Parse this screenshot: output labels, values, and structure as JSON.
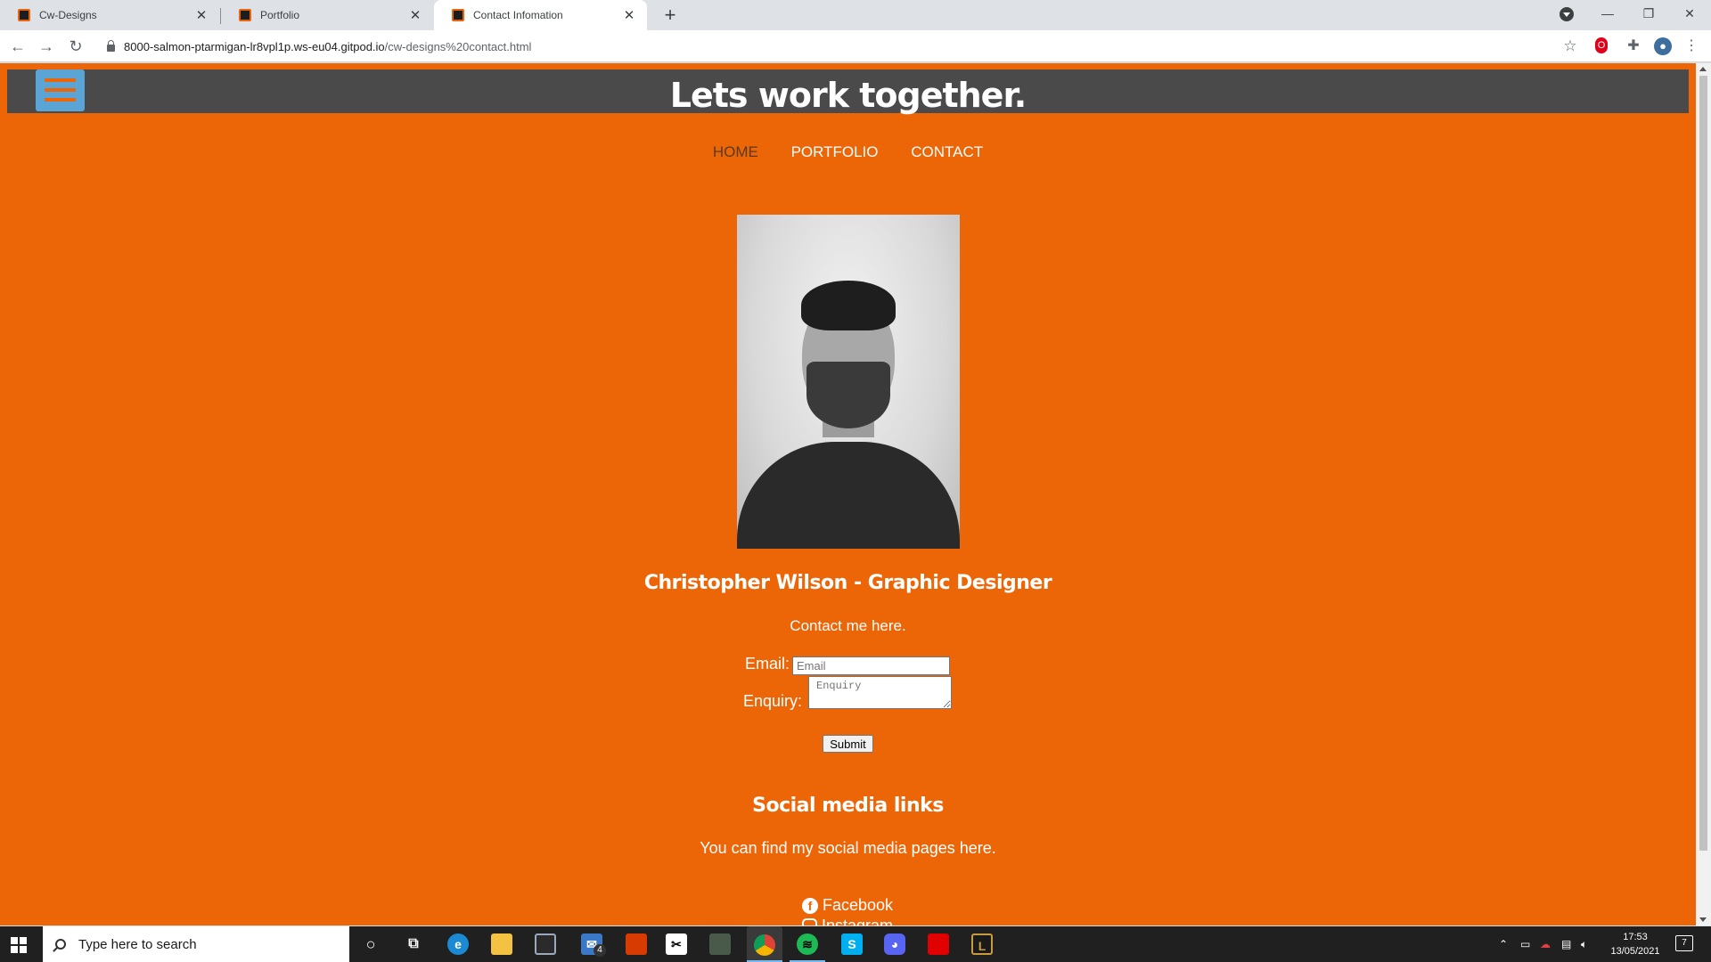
{
  "browser": {
    "tabs": [
      {
        "title": "Cw-Designs"
      },
      {
        "title": "Portfolio"
      },
      {
        "title": "Contact Infomation"
      }
    ],
    "url_host": "8000-salmon-ptarmigan-lr8vpl1p.ws-eu04.gitpod.io",
    "url_path": "/cw-designs%20contact.html"
  },
  "page": {
    "header_title": "Lets work together.",
    "nav": [
      "HOME",
      "PORTFOLIO",
      "CONTACT"
    ],
    "name_title": "Christopher Wilson - Graphic Designer",
    "contact_intro": "Contact me here.",
    "email_label": "Email:",
    "email_placeholder": "Email",
    "enquiry_label": "Enquiry:",
    "enquiry_placeholder": "Enquiry",
    "submit_label": "Submit",
    "social_title": "Social media links",
    "social_intro": "You can find my social media pages here.",
    "social_links": [
      "Facebook",
      "Instagram"
    ]
  },
  "taskbar": {
    "search_placeholder": "Type here to search",
    "mail_badge": "4",
    "time": "17:53",
    "date": "13/05/2021",
    "notification_count": "7"
  },
  "colors": {
    "page_bg": "#ec6608",
    "header_bg": "#4a4a4a",
    "menu_button": "#5ba4d6"
  }
}
